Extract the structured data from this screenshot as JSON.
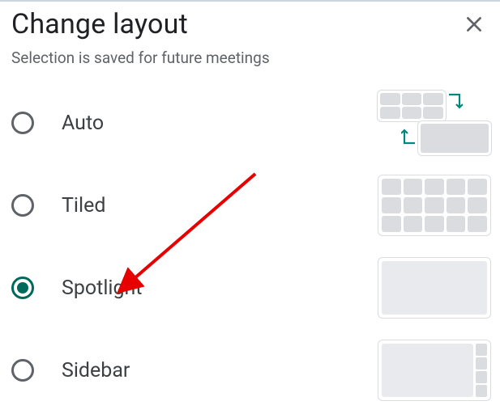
{
  "dialog": {
    "title": "Change layout",
    "subtitle": "Selection is saved for future meetings"
  },
  "options": [
    {
      "id": "auto",
      "label": "Auto",
      "selected": false
    },
    {
      "id": "tiled",
      "label": "Tiled",
      "selected": false
    },
    {
      "id": "spotlight",
      "label": "Spotlight",
      "selected": true
    },
    {
      "id": "sidebar",
      "label": "Sidebar",
      "selected": false
    }
  ],
  "annotation": {
    "type": "arrow",
    "color": "#e60000",
    "target": "spotlight"
  }
}
